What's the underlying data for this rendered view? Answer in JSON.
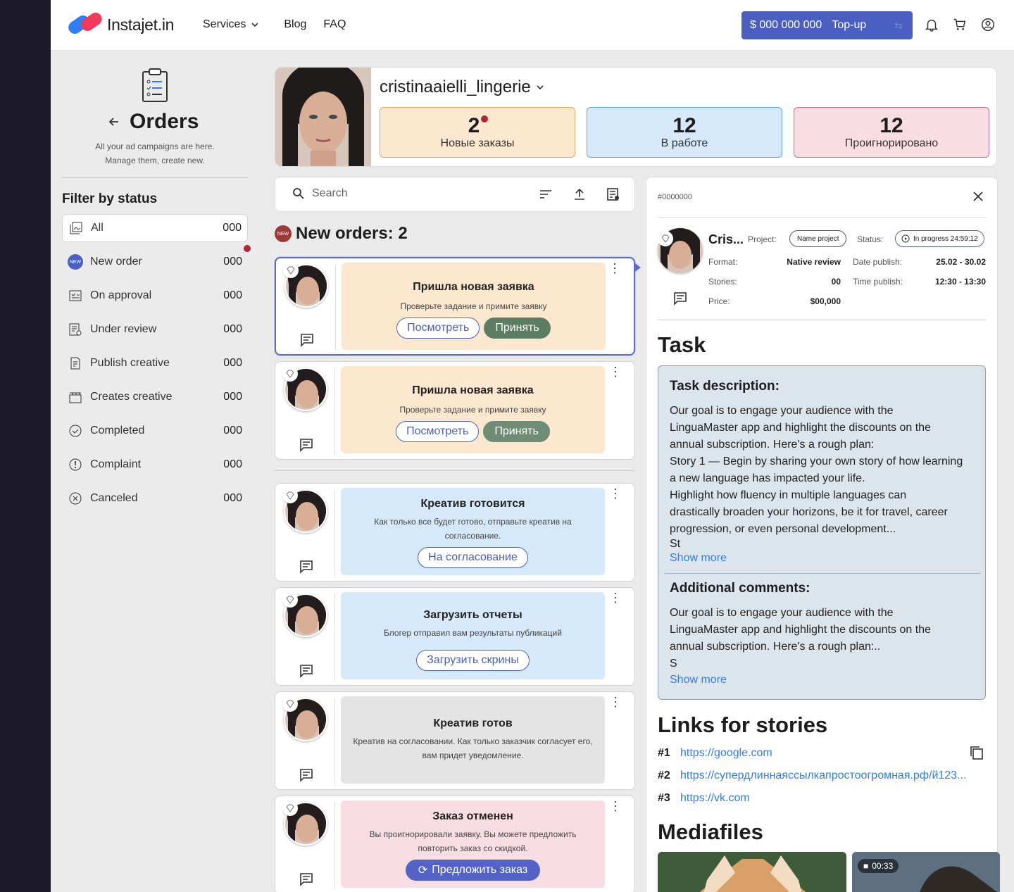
{
  "header": {
    "logo_text": "Instajet.in",
    "nav": {
      "services": "Services",
      "blog": "Blog",
      "faq": "FAQ"
    },
    "balance": "$ 000 000 000",
    "topup_label": "Top-up"
  },
  "sidebar": {
    "title": "Orders",
    "subtitle_line1": "All your ad campaigns are here.",
    "subtitle_line2": "Manage them, create new.",
    "filter_title": "Filter by status",
    "new_badge": "NEW",
    "items": [
      {
        "label": "All",
        "count": "000"
      },
      {
        "label": "New order",
        "count": "000"
      },
      {
        "label": "On approval",
        "count": "000"
      },
      {
        "label": "Under review",
        "count": "000"
      },
      {
        "label": "Publish creative",
        "count": "000"
      },
      {
        "label": "Creates creative",
        "count": "000"
      },
      {
        "label": "Completed",
        "count": "000"
      },
      {
        "label": "Complaint",
        "count": "000"
      },
      {
        "label": "Canceled",
        "count": "000"
      }
    ]
  },
  "profile": {
    "username": "cristinaaielli_lingerie",
    "stats": [
      {
        "num": "2",
        "label": "Новые заказы",
        "color": "#fbe8cf"
      },
      {
        "num": "12",
        "label": "В работе",
        "color": "#d6e9fa"
      },
      {
        "num": "12",
        "label": "Проигнорировано",
        "color": "#f8dde3"
      }
    ]
  },
  "search": {
    "placeholder": "Search"
  },
  "list": {
    "new_badge": "NEW",
    "heading": "New orders: 2",
    "cards": [
      {
        "title": "Пришла новая заявка",
        "text": "Проверьте задание и примите заявку",
        "btn_view": "Посмотреть",
        "btn_accept": "Принять"
      },
      {
        "title": "Пришла новая заявка",
        "text": "Проверьте задание и примите заявку",
        "btn_view": "Посмотреть",
        "btn_accept": "Принять"
      },
      {
        "title": "Креатив готовится",
        "text": "Как только все будет готово, отправьте креатив на согласование.",
        "btn": "На согласование"
      },
      {
        "title": "Загрузить отчеты",
        "text": "Блогер отправил вам результаты публикаций",
        "btn": "Загрузить скрины"
      },
      {
        "title": "Креатив готов",
        "text": "Креатив на согласовании. Как только заказчик согласует его, вам придет уведомление."
      },
      {
        "title": "Заказ отменен",
        "text": "Вы проигнорировали заявку. Вы можете предложить повторить заказ со скидкой.",
        "btn": "Предложить заказ"
      }
    ]
  },
  "detail": {
    "order_id": "#0000000",
    "name": "Cris...",
    "project_label": "Project:",
    "project_value": "Name project",
    "status_label": "Status:",
    "status_value": "In progress 24:59:12",
    "format_label": "Format:",
    "format_value": "Native review",
    "stories_label": "Stories:",
    "stories_value": "00",
    "price_label": "Price:",
    "price_value": "$00,000",
    "date_label": "Date publish:",
    "date_value": "25.02 - 30.02",
    "time_label": "Time publish:",
    "time_value": "12:30 - 13:30",
    "task_heading": "Task",
    "task_desc_heading": "Task description:",
    "task_desc_lines": [
      "Our goal is to engage your audience with the",
      "LinguaMaster app and highlight the discounts on the",
      "annual subscription. Here's a rough plan:",
      "Story 1 — Begin by sharing your own story of how learning",
      "a new language has impacted your life.",
      "Highlight how fluency in multiple languages can",
      "drastically broaden your horizons, be it for travel, career",
      "progression, or even personal development...",
      "St"
    ],
    "show_more": "Show more",
    "comments_heading": "Additional comments:",
    "comments_lines": [
      "Our goal is to engage your audience with the",
      "LinguaMaster app and highlight the discounts on the",
      "annual subscription. Here's a rough plan:..",
      "S"
    ],
    "links_heading": "Links for stories",
    "links": [
      {
        "n": "#1",
        "url": "https://google.com"
      },
      {
        "n": "#2",
        "url": "https://супердлиннаяссылкапростоогромная.рф/й123..."
      },
      {
        "n": "#3",
        "url": "https://vk.com"
      }
    ],
    "media_heading": "Mediafiles",
    "video_duration": "00:33"
  }
}
